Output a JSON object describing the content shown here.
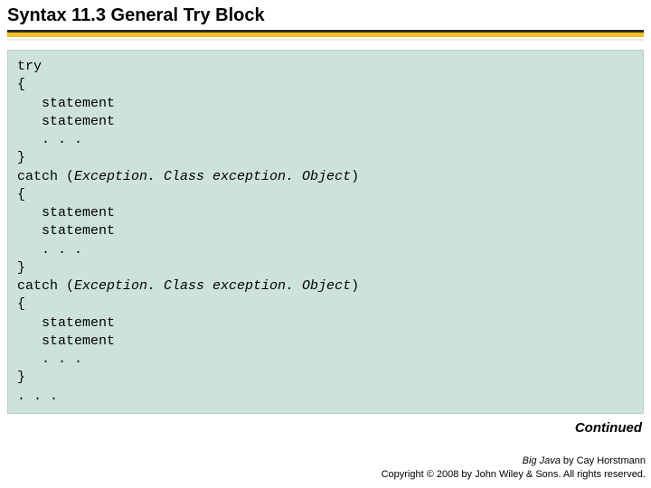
{
  "title": {
    "prefix": "Syntax 11.3",
    "main": " General Try Block"
  },
  "code": {
    "l1": "try",
    "l2": "{",
    "l3": "   statement",
    "l4": "   statement",
    "l5": "   . . .",
    "l6": "}",
    "l7a": "catch (",
    "l7b": "Exception. Class exception. Object",
    "l7c": ")",
    "l8": "{",
    "l9": "   statement",
    "l10": "   statement",
    "l11": "   . . .",
    "l12": "}",
    "l13a": "catch (",
    "l13b": "Exception. Class exception. Object",
    "l13c": ")",
    "l14": "{",
    "l15": "   statement",
    "l16": "   statement",
    "l17": "   . . .",
    "l18": "}",
    "l19": ". . ."
  },
  "continued": "Continued",
  "footer": {
    "book": "Big Java",
    "by": " by Cay Horstmann",
    "copyright": "Copyright © 2008 by John Wiley & Sons. All rights reserved."
  }
}
